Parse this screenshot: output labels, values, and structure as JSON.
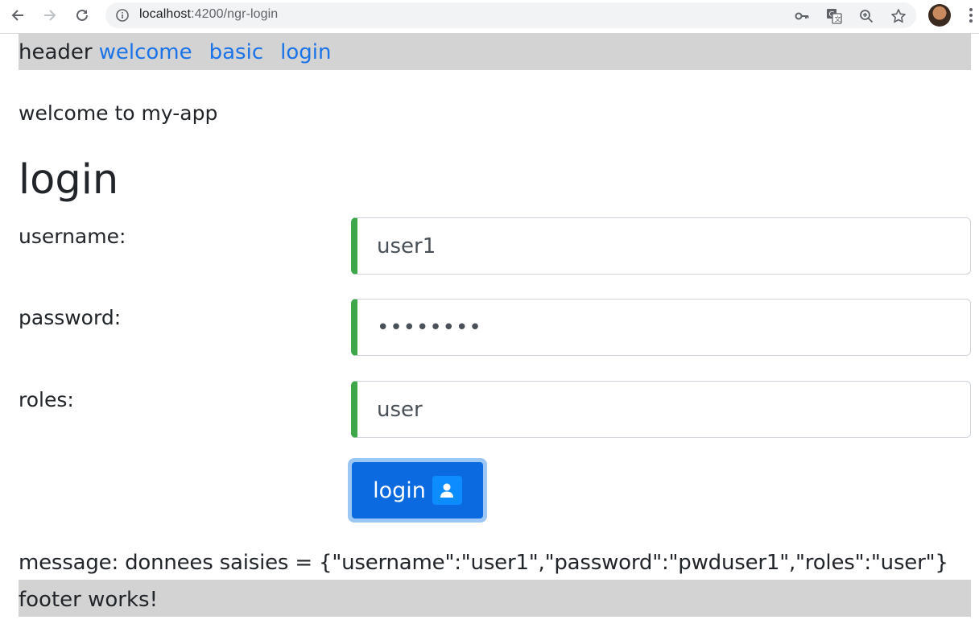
{
  "browser": {
    "url_host": "localhost",
    "url_path": ":4200/ngr-login"
  },
  "header": {
    "text": "header",
    "links": [
      "welcome",
      "basic",
      "login"
    ]
  },
  "welcome_text": "welcome to my-app",
  "page_title": "login",
  "form": {
    "username_label": "username:",
    "username_value": "user1",
    "password_label": "password:",
    "password_value": "pwduser1",
    "roles_label": "roles:",
    "roles_value": "user",
    "accent_color": "#3ea749"
  },
  "login_button": "login",
  "message": "message: donnees saisies = {\"username\":\"user1\",\"password\":\"pwduser1\",\"roles\":\"user\"}",
  "footer": "footer works!"
}
